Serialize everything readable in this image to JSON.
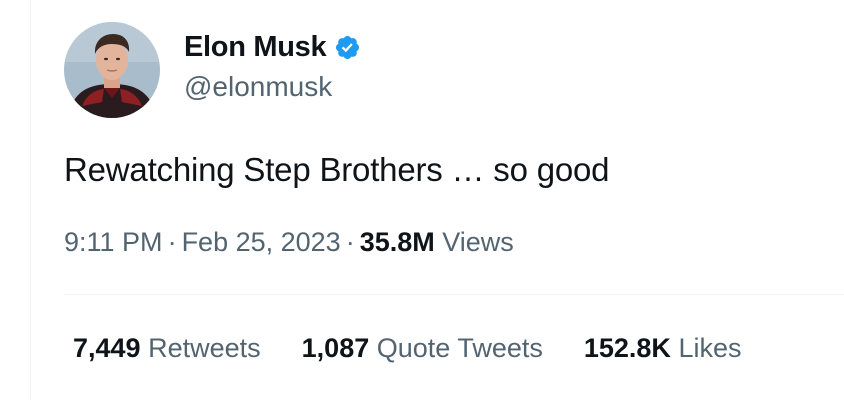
{
  "author": {
    "display_name": "Elon Musk",
    "handle": "@elonmusk",
    "verified_icon": "verified-badge-icon",
    "verified_color": "#1d9bf0"
  },
  "tweet": {
    "text": "Rewatching Step Brothers … so good"
  },
  "meta": {
    "time": "9:11 PM",
    "separator": "·",
    "date": "Feb 25, 2023",
    "views_count": "35.8M",
    "views_label": "Views"
  },
  "stats": {
    "retweets": {
      "count": "7,449",
      "label": "Retweets"
    },
    "quote_tweets": {
      "count": "1,087",
      "label": "Quote Tweets"
    },
    "likes": {
      "count": "152.8K",
      "label": "Likes"
    }
  },
  "colors": {
    "text_primary": "#0f1419",
    "text_secondary": "#536471",
    "divider": "#eff3f4",
    "accent": "#1d9bf0"
  }
}
